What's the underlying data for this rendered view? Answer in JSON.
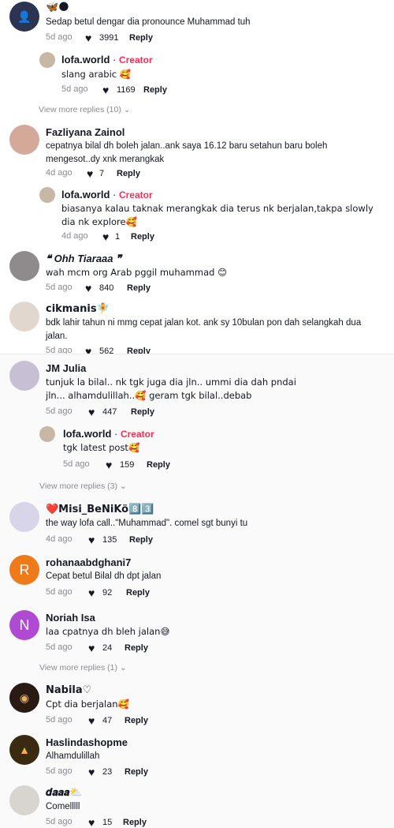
{
  "colors": {
    "creator": "#fe2c55",
    "secondary": "#8a8b91",
    "avatar_r": "#ef7a1a",
    "avatar_n": "#b14ad3"
  },
  "top": {
    "c1": {
      "name_emoji": "🦋🌑",
      "text": "Sedap betul dengar dia pronounce Muhammad tuh",
      "age": "5d ago",
      "likes": "3991",
      "reply": "Reply"
    },
    "c1r": {
      "name": "lofa.world",
      "tag": "Creator",
      "text": "slang arabic 🥰",
      "age": "5d ago",
      "likes": "1169",
      "reply": "Reply"
    },
    "c1more": "View more replies (10) ⌄",
    "c2": {
      "name": "Fazliyana Zainol",
      "text": "cepatnya bilal dh boleh jalan..ank saya 16.12 baru setahun baru boleh mengesot..dy xnk merangkak",
      "age": "4d ago",
      "likes": "7",
      "reply": "Reply"
    },
    "c2r": {
      "name": "lofa.world",
      "tag": "Creator",
      "text": "biasanya kalau taknak merangkak dia terus nk berjalan,takpa slowly dia nk explore🥰",
      "age": "4d ago",
      "likes": "1",
      "reply": "Reply"
    },
    "c3": {
      "name": "❝ Ohh Tiaraaa ❞",
      "text": "wah mcm org Arab pggil muhammad 😊",
      "age": "5d ago",
      "likes": "840",
      "reply": "Reply"
    },
    "c4": {
      "name": "cikmanis🧚",
      "text": "bdk lahir tahun ni mmg cepat jalan kot. ank sy 10bulan pon dah selangkah dua jalan.",
      "age": "5d ago",
      "likes": "562",
      "reply": "Reply"
    }
  },
  "bottom": {
    "c5": {
      "name": "JM Julia",
      "text": "tunjuk la bilal.. nk tgk juga dia jln.. ummi dia dah pndai jln... alhamdulillah..🥰 geram tgk bilal..debab",
      "age": "5d ago",
      "likes": "447",
      "reply": "Reply"
    },
    "c5r": {
      "name": "lofa.world",
      "tag": "Creator",
      "text": "tgk latest post🥰",
      "age": "5d ago",
      "likes": "159",
      "reply": "Reply"
    },
    "c5more": "View more replies (3) ⌄",
    "c6": {
      "name": "❤️Misi_BeNiKö8️⃣3️⃣",
      "text": "the way lofa call..\"Muhammad\". comel sgt bunyi tu",
      "age": "4d ago",
      "likes": "135",
      "reply": "Reply"
    },
    "c7": {
      "initial": "R",
      "name": "rohanaabdghani7",
      "text": "Cepat betul Bilal dh dpt jalan",
      "age": "5d ago",
      "likes": "92",
      "reply": "Reply"
    },
    "c8": {
      "initial": "N",
      "name": "Noriah Isa",
      "text": "laa cpatnya dh bleh jalan😅",
      "age": "5d ago",
      "likes": "24",
      "reply": "Reply"
    },
    "c8more": "View more replies (1) ⌄",
    "c9": {
      "name": "Nabila♡",
      "text": "Cpt dia berjalan🥰",
      "age": "5d ago",
      "likes": "47",
      "reply": "Reply"
    },
    "c10": {
      "name": "Haslindashopme",
      "text": "Alhamdulillah",
      "age": "5d ago",
      "likes": "23",
      "reply": "Reply"
    },
    "c11": {
      "name": "𝒅𝒂𝒂𝒂⛅",
      "text": "Comelllll",
      "age": "5d ago",
      "likes": "15",
      "reply": "Reply"
    }
  },
  "icons": {
    "like": "heart-icon",
    "chevron": "chevron-down-icon"
  }
}
